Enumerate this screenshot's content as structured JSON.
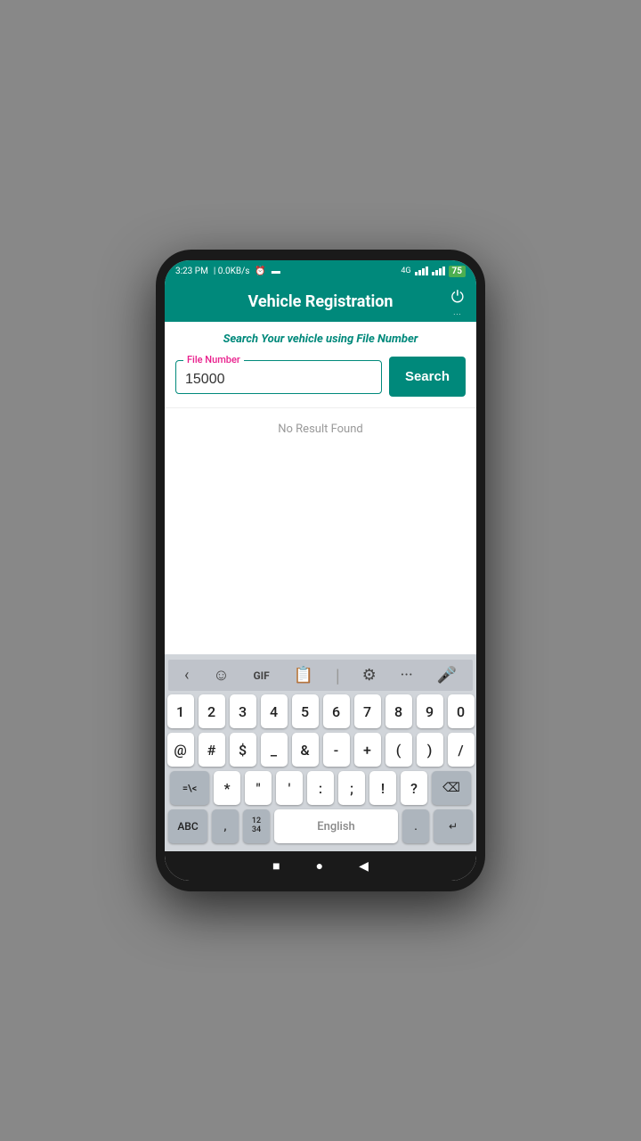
{
  "status_bar": {
    "time": "3:23 PM",
    "data": "0.0KB/s",
    "battery": "75"
  },
  "header": {
    "title": "Vehicle Registration",
    "power_dots": "..."
  },
  "content": {
    "instruction": "Search Your vehicle using File Number",
    "field_label": "File Number",
    "field_value": "15000",
    "search_button": "Search",
    "no_result": "No Result Found"
  },
  "keyboard": {
    "row1": [
      "1",
      "2",
      "3",
      "4",
      "5",
      "6",
      "7",
      "8",
      "9",
      "0"
    ],
    "row2": [
      "@",
      "#",
      "$",
      "_",
      "&",
      "-",
      "+",
      "(",
      ")",
      "/"
    ],
    "row3": [
      "=\\<",
      "*",
      "\"",
      "'",
      ":",
      ";",
      "!",
      "?"
    ],
    "bottom": {
      "abc": "ABC",
      "numbers": "12\n34",
      "language": "English",
      "period": ".",
      "enter": "↵"
    }
  },
  "navbar": {
    "stop": "■",
    "home": "●",
    "back": "◀"
  }
}
